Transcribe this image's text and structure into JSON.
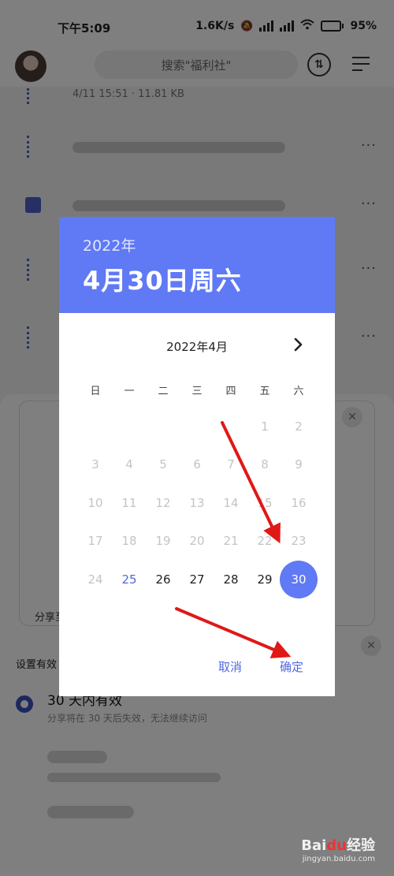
{
  "status_bar": {
    "time": "下午5:09",
    "speed": "1.6K/s",
    "battery": "95"
  },
  "header": {
    "search_placeholder": "搜索\"福利社\"",
    "sort_icon": "sort-icon",
    "menu_icon": "menu-icon"
  },
  "file_list": {
    "first_meta": "4/11 15:51 · 11.81 KB",
    "more": "···"
  },
  "share_sheet": {
    "share_label": "分享至",
    "validity_title": "设置有效",
    "option_main": "30 天内有效",
    "option_sub": "分享将在 30 天后失效，无法继续访问"
  },
  "dialog": {
    "year": "2022年",
    "date": "4月30日周六",
    "month_title": "2022年4月",
    "weekdays": [
      "日",
      "一",
      "二",
      "三",
      "四",
      "五",
      "六"
    ],
    "days": [
      {
        "n": "1",
        "state": "disabled"
      },
      {
        "n": "2",
        "state": "disabled"
      },
      {
        "n": "3",
        "state": "disabled"
      },
      {
        "n": "4",
        "state": "disabled"
      },
      {
        "n": "5",
        "state": "disabled"
      },
      {
        "n": "6",
        "state": "disabled"
      },
      {
        "n": "7",
        "state": "disabled"
      },
      {
        "n": "8",
        "state": "disabled"
      },
      {
        "n": "9",
        "state": "disabled"
      },
      {
        "n": "10",
        "state": "disabled"
      },
      {
        "n": "11",
        "state": "disabled"
      },
      {
        "n": "12",
        "state": "disabled"
      },
      {
        "n": "13",
        "state": "disabled"
      },
      {
        "n": "14",
        "state": "disabled"
      },
      {
        "n": "15",
        "state": "disabled"
      },
      {
        "n": "16",
        "state": "disabled"
      },
      {
        "n": "17",
        "state": "disabled"
      },
      {
        "n": "18",
        "state": "disabled"
      },
      {
        "n": "19",
        "state": "disabled"
      },
      {
        "n": "20",
        "state": "disabled"
      },
      {
        "n": "21",
        "state": "disabled"
      },
      {
        "n": "22",
        "state": "disabled"
      },
      {
        "n": "23",
        "state": "disabled"
      },
      {
        "n": "24",
        "state": "disabled"
      },
      {
        "n": "25",
        "state": "today"
      },
      {
        "n": "26",
        "state": "active"
      },
      {
        "n": "27",
        "state": "active"
      },
      {
        "n": "28",
        "state": "active"
      },
      {
        "n": "29",
        "state": "active"
      },
      {
        "n": "30",
        "state": "selected"
      }
    ],
    "cancel_label": "取消",
    "confirm_label": "确定",
    "accent_color": "#6079f5"
  },
  "watermark": {
    "brand_a": "Bai",
    "brand_b": "du",
    "brand_c": "经验",
    "url": "jingyan.baidu.com"
  }
}
